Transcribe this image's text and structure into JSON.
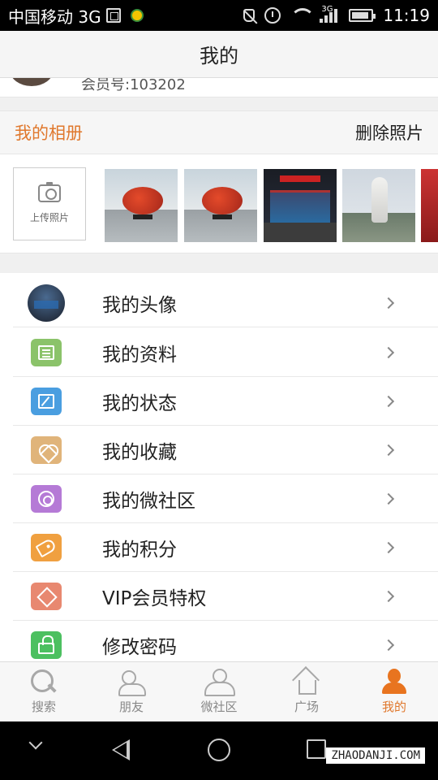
{
  "status_bar": {
    "carrier": "中国移动 3G",
    "network": "3G",
    "time": "11:19"
  },
  "header": {
    "title": "我的"
  },
  "member": {
    "number_label": "会员号:103202"
  },
  "album": {
    "title": "我的相册",
    "delete_label": "删除照片",
    "upload_label": "上传照片",
    "photos": [
      {
        "icon": "basketball-sculpture-photo"
      },
      {
        "icon": "basketball-sculpture-photo"
      },
      {
        "icon": "building-night-photo"
      },
      {
        "icon": "statue-photo"
      },
      {
        "icon": "red-photo"
      }
    ]
  },
  "menu": {
    "items": [
      {
        "label": "我的头像",
        "icon": "avatar-thumb",
        "color": "#3a4a60"
      },
      {
        "label": "我的资料",
        "icon": "profile-doc-icon",
        "color": "#8bc36a"
      },
      {
        "label": "我的状态",
        "icon": "edit-status-icon",
        "color": "#4a9ee0"
      },
      {
        "label": "我的收藏",
        "icon": "heart-icon",
        "color": "#e0b47a"
      },
      {
        "label": "我的微社区",
        "icon": "community-icon",
        "color": "#b57ad6"
      },
      {
        "label": "我的积分",
        "icon": "tag-icon",
        "color": "#f0a040"
      },
      {
        "label": "VIP会员特权",
        "icon": "diamond-icon",
        "color": "#e88870"
      },
      {
        "label": "修改密码",
        "icon": "lock-icon",
        "color": "#4cc060"
      }
    ]
  },
  "tabbar": {
    "tabs": [
      {
        "label": "搜索",
        "icon": "search-icon"
      },
      {
        "label": "朋友",
        "icon": "friends-icon"
      },
      {
        "label": "微社区",
        "icon": "community-icon"
      },
      {
        "label": "广场",
        "icon": "home-icon"
      },
      {
        "label": "我的",
        "icon": "user-icon",
        "active": true
      }
    ]
  },
  "watermark": "ZHAODANJI.COM",
  "colors": {
    "accent": "#e0782d"
  }
}
